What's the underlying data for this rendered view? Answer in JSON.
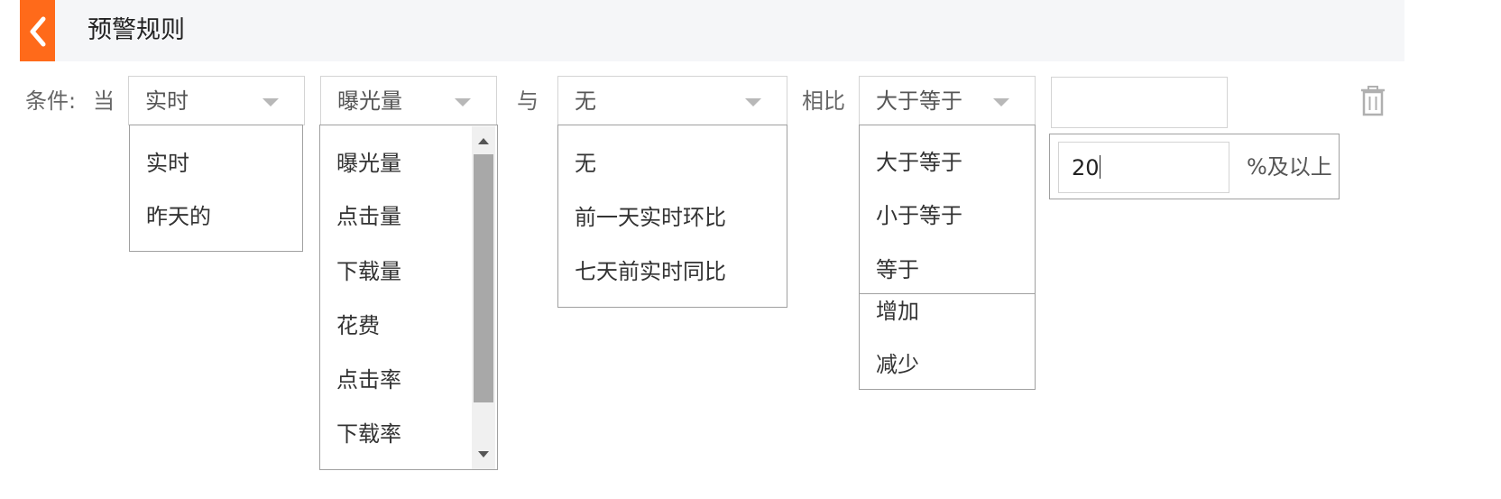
{
  "header": {
    "title": "预警规则",
    "back_icon": "chevron-left-icon",
    "accent": "#ff6a1a"
  },
  "condition": {
    "label": "条件:",
    "when_label": "当",
    "with_label": "与",
    "compare_label": "相比",
    "time_select": {
      "value": "实时",
      "options": [
        "实时",
        "昨天的"
      ]
    },
    "metric_select": {
      "value": "曝光量",
      "options": [
        "曝光量",
        "点击量",
        "下载量",
        "花费",
        "点击率",
        "下载率"
      ]
    },
    "baseline_select": {
      "value": "无",
      "options": [
        "无",
        "前一天实时环比",
        "七天前实时同比"
      ]
    },
    "operator_select": {
      "value": "大于等于",
      "options": [
        "大于等于",
        "小于等于",
        "等于",
        "增加",
        "减少"
      ]
    },
    "value_input": {
      "value": ""
    },
    "percent_input": {
      "value": "20",
      "suffix": "%及以上"
    },
    "delete_icon": "trash-icon"
  }
}
